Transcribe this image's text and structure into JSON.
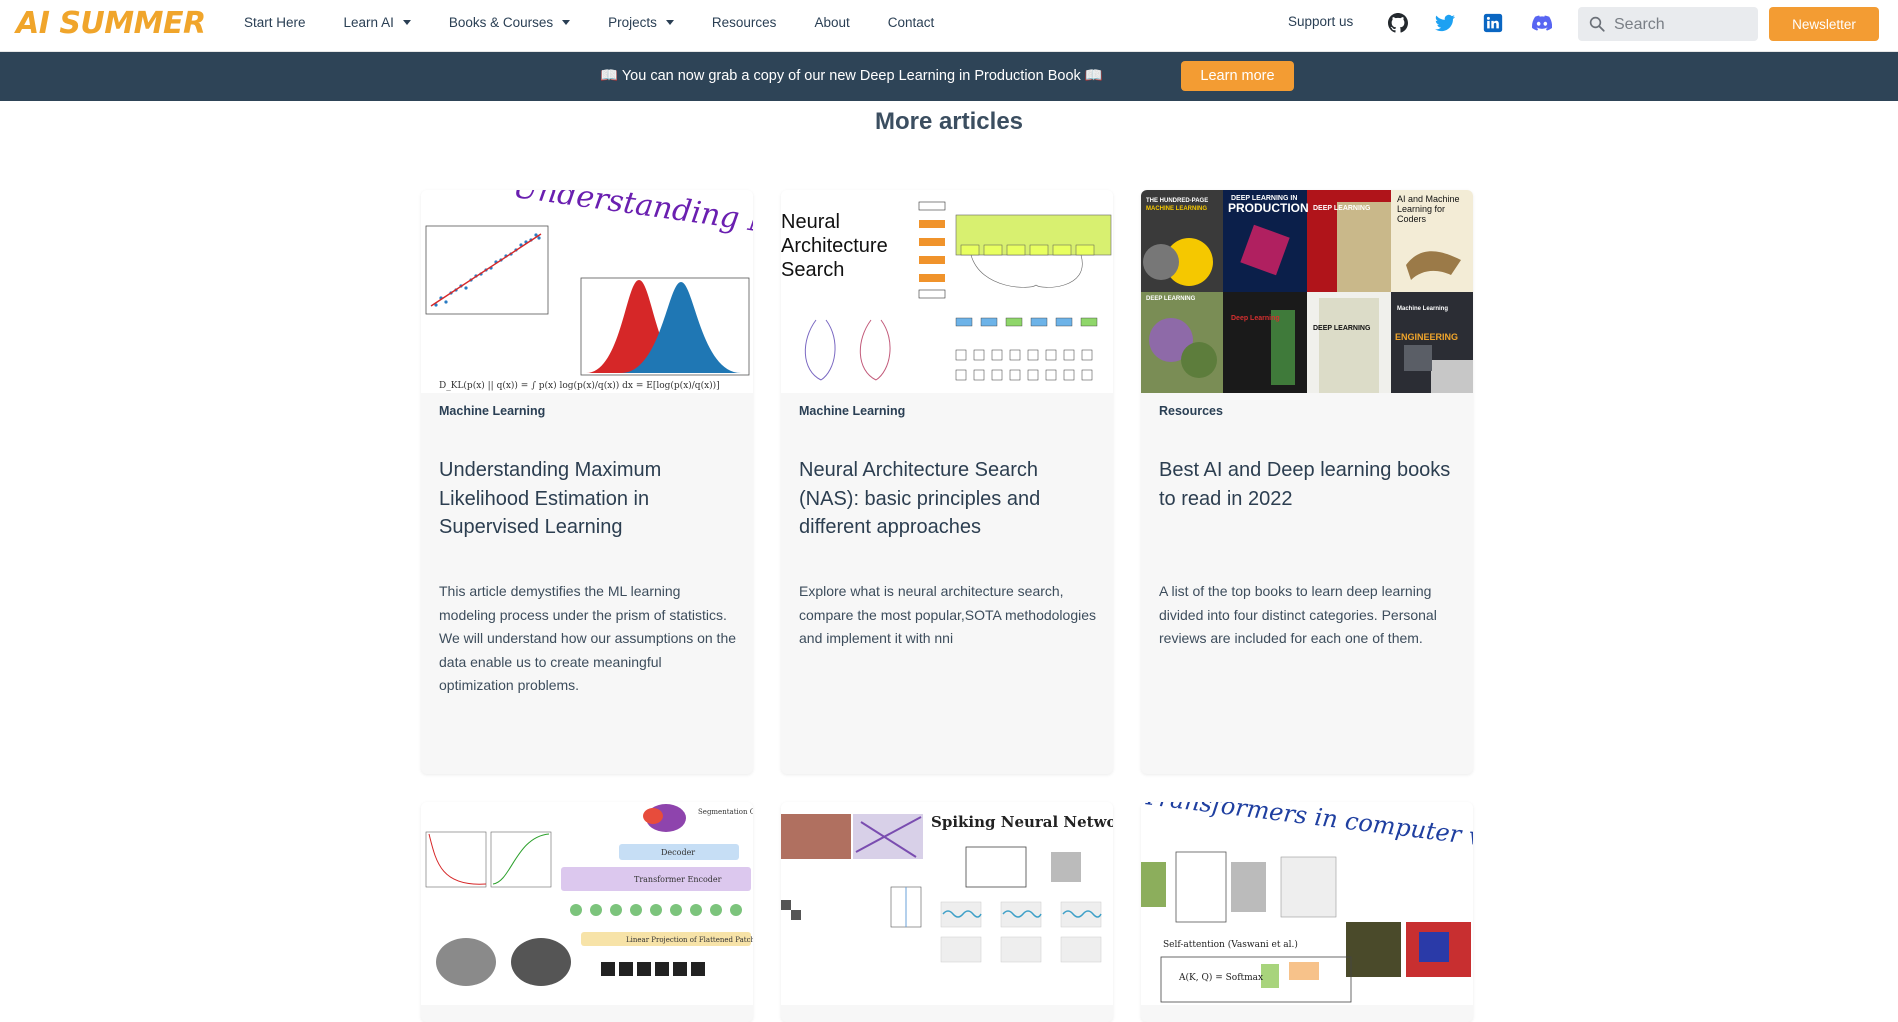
{
  "header": {
    "logo": "AI SUMMER",
    "nav": [
      {
        "label": "Start Here",
        "dropdown": false
      },
      {
        "label": "Learn AI",
        "dropdown": true
      },
      {
        "label": "Books & Courses",
        "dropdown": true
      },
      {
        "label": "Projects",
        "dropdown": true
      },
      {
        "label": "Resources",
        "dropdown": false
      },
      {
        "label": "About",
        "dropdown": false
      },
      {
        "label": "Contact",
        "dropdown": false
      }
    ],
    "support_label": "Support us",
    "social_icons": [
      "github-icon",
      "twitter-icon",
      "linkedin-icon",
      "discord-icon"
    ],
    "search_placeholder": "Search",
    "newsletter_label": "Newsletter"
  },
  "banner": {
    "text": "📖 You can now grab a copy of our new Deep Learning in Production Book 📖",
    "button_label": "Learn more"
  },
  "section": {
    "title": "More articles"
  },
  "cards": [
    {
      "category": "Machine Learning",
      "title": "Understanding Maximum Likelihood Estimation in Supervised Learning",
      "description": "This article demystifies the ML learning modeling process under the prism of statistics. We will understand how our assumptions on the data enable us to create meaningful optimization problems.",
      "thumb_text": "Understanding MLE"
    },
    {
      "category": "Machine Learning",
      "title": "Neural Architecture Search (NAS): basic principles and different approaches",
      "description": "Explore what is neural architecture search, compare the most popular,SOTA methodologies and implement it with nni",
      "thumb_text": "Neural Architecture Search"
    },
    {
      "category": "Resources",
      "title": "Best AI and Deep learning books to read in 2022",
      "description": "A list of the top books to learn deep learning divided into four distinct categories. Personal reviews are included for each one of them.",
      "thumb_text": ""
    },
    {
      "thumb_text": "Segmentation Output"
    },
    {
      "thumb_text": "Spiking Neural Networks"
    },
    {
      "thumb_text": "Transformers in computer vision"
    }
  ],
  "colors": {
    "accent": "#f39c33",
    "banner": "#2e4457",
    "text": "#2a3f54"
  }
}
